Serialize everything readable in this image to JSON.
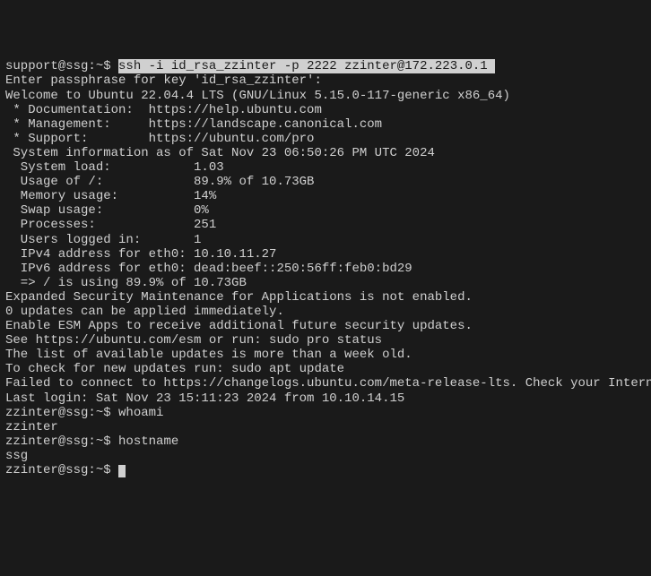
{
  "initial_prompt": {
    "prefix": "support@ssg:~$ ",
    "command": "ssh -i id_rsa_zzinter -p 2222 zzinter@172.223.0.1 "
  },
  "lines": {
    "l1": "Enter passphrase for key 'id_rsa_zzinter':",
    "l2": "Welcome to Ubuntu 22.04.4 LTS (GNU/Linux 5.15.0-117-generic x86_64)",
    "l3": "",
    "l4": " * Documentation:  https://help.ubuntu.com",
    "l5": " * Management:     https://landscape.canonical.com",
    "l6": " * Support:        https://ubuntu.com/pro",
    "l7": "",
    "l8": " System information as of Sat Nov 23 06:50:26 PM UTC 2024",
    "l9": "",
    "l10": "  System load:           1.03",
    "l11": "  Usage of /:            89.9% of 10.73GB",
    "l12": "  Memory usage:          14%",
    "l13": "  Swap usage:            0%",
    "l14": "  Processes:             251",
    "l15": "  Users logged in:       1",
    "l16": "  IPv4 address for eth0: 10.10.11.27",
    "l17": "  IPv6 address for eth0: dead:beef::250:56ff:feb0:bd29",
    "l18": "",
    "l19": "  => / is using 89.9% of 10.73GB",
    "l20": "",
    "l21": "",
    "l22": "Expanded Security Maintenance for Applications is not enabled.",
    "l23": "",
    "l24": "0 updates can be applied immediately.",
    "l25": "",
    "l26": "Enable ESM Apps to receive additional future security updates.",
    "l27": "See https://ubuntu.com/esm or run: sudo pro status",
    "l28": "",
    "l29": "",
    "l30": "The list of available updates is more than a week old.",
    "l31": "To check for new updates run: sudo apt update",
    "l32": "Failed to connect to https://changelogs.ubuntu.com/meta-release-lts. Check your Internet c",
    "l33": "",
    "l34": "",
    "l35": "Last login: Sat Nov 23 15:11:23 2024 from 10.10.14.15"
  },
  "session": {
    "p1_prompt": "zzinter@ssg:~$ ",
    "p1_cmd": "whoami",
    "p1_out": "zzinter",
    "p2_prompt": "zzinter@ssg:~$ ",
    "p2_cmd": "hostname",
    "p2_out": "ssg",
    "p3_prompt": "zzinter@ssg:~$ "
  }
}
